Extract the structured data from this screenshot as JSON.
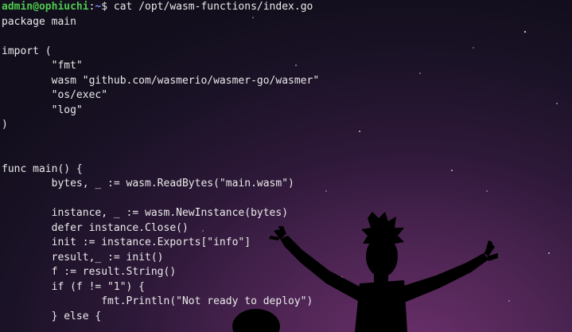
{
  "prompt": {
    "user_host": "admin@ophiuchi",
    "separator": ":",
    "path": "~",
    "dollar": "$",
    "command": " cat /opt/wasm-functions/index.go"
  },
  "code_lines": [
    "package main",
    "",
    "import (",
    "        \"fmt\"",
    "        wasm \"github.com/wasmerio/wasmer-go/wasmer\"",
    "        \"os/exec\"",
    "        \"log\"",
    ")",
    "",
    "",
    "func main() {",
    "        bytes, _ := wasm.ReadBytes(\"main.wasm\")",
    "",
    "        instance, _ := wasm.NewInstance(bytes)",
    "        defer instance.Close()",
    "        init := instance.Exports[\"info\"]",
    "        result,_ := init()",
    "        f := result.String()",
    "        if (f != \"1\") {",
    "                fmt.Println(\"Not ready to deploy\")",
    "        } else {"
  ],
  "colors": {
    "background": "#1a1226",
    "text": "#eaeaea",
    "prompt_user": "#4ec94e",
    "prompt_path": "#6a8cf0",
    "silhouette": "#000000"
  }
}
